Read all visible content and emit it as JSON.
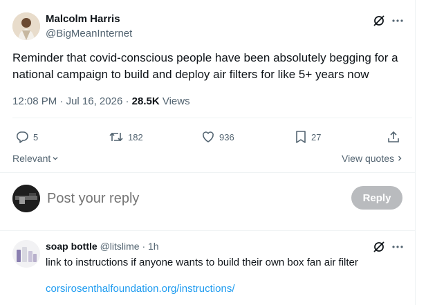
{
  "tweet": {
    "author_name": "Malcolm Harris",
    "author_handle": "@BigMeanInternet",
    "text": "Reminder that covid-conscious people have been absolutely begging for a national campaign to build and deploy air filters for like 5+ years now",
    "time": "12:08 PM",
    "separator": "·",
    "date": "Jul 16, 2026",
    "views_count": "28.5K",
    "views_label": "Views",
    "more_icon": "ellipsis-icon",
    "grok_icon": "slashed-circle-icon"
  },
  "actions": {
    "replies": "5",
    "reposts": "182",
    "likes": "936",
    "bookmarks": "27",
    "icons": [
      "reply-icon",
      "repost-icon",
      "like-icon",
      "bookmark-icon",
      "share-icon"
    ]
  },
  "sort": {
    "label": "Relevant",
    "view_quotes": "View quotes"
  },
  "composer": {
    "placeholder": "Post your reply",
    "reply_button": "Reply"
  },
  "reply": {
    "author_name": "soap bottle",
    "author_handle": "@litslime",
    "separator": "·",
    "age": "1h",
    "text": "link to instructions if anyone wants to build their own box fan air filter",
    "link": "corsirosenthalfoundation.org/instructions/"
  },
  "colors": {
    "accent": "#1d9bf0",
    "text": "#0f1419",
    "muted": "#536471",
    "reply_button_bg": "#b9bbbe",
    "divider": "#eff3f4"
  }
}
